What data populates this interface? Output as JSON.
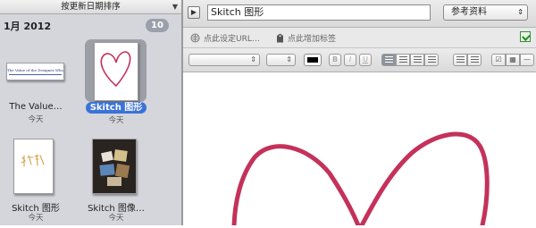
{
  "sidebar": {
    "sort_label": "按更新日期排序",
    "group": {
      "title": "1月 2012",
      "count": "10"
    },
    "notes": [
      {
        "label": "The Value…",
        "date": "今天",
        "thumb_text": "The Value of the Designer Who Codes"
      },
      {
        "label": "Skitch 图形",
        "date": "今天",
        "selected": true
      },
      {
        "label": "Skitch 图形",
        "date": "今天"
      },
      {
        "label": "Skitch 图像…",
        "date": "今天"
      }
    ]
  },
  "note": {
    "title": "Skitch 图形",
    "notebook": "参考资料",
    "url_placeholder": "点此设定URL…",
    "tags_placeholder": "点此增加标签"
  },
  "colors": {
    "selection": "#3b73d7",
    "heart": "#c4315b"
  }
}
